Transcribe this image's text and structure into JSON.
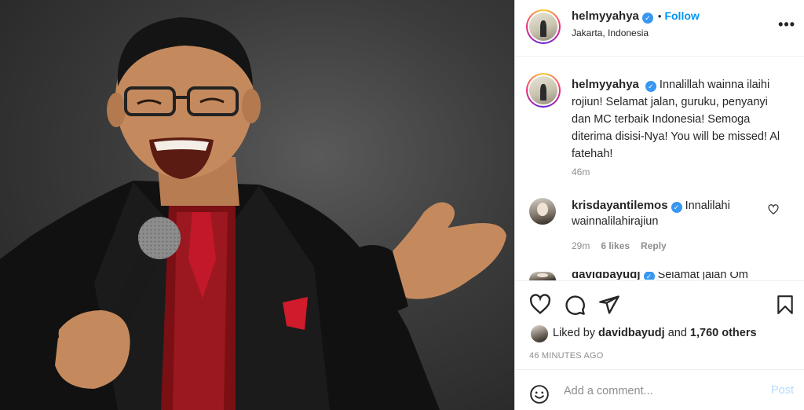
{
  "post": {
    "author": "helmyyahya",
    "follow_label": "Follow",
    "separator": "•",
    "location": "Jakarta, Indonesia",
    "more_label": "•••",
    "verified_mark": "✓"
  },
  "caption": {
    "username": "helmyyahya",
    "text": "Innalillah wainna ilaihi rojiun! Selamat jalan, guruku, penyanyi dan MC terbaik Indonesia! Semoga diterima disisi-Nya! You will be missed! Al fatehah!",
    "time": "46m"
  },
  "comments": [
    {
      "username": "krisdayantilemos",
      "text": "Innalilahi wainnalilahirajiun",
      "time": "29m",
      "likes": "6 likes",
      "reply_label": "Reply"
    },
    {
      "username": "davidbayudj",
      "text": "Selamat jalan Om"
    }
  ],
  "likes": {
    "prefix": "Liked by",
    "user": "davidbayudj",
    "joiner": "and",
    "others": "1,760 others"
  },
  "timestamp": "46 MINUTES AGO",
  "comment_box": {
    "placeholder": "Add a comment...",
    "post_label": "Post"
  },
  "icons": {
    "like": "heart-icon",
    "comment": "comment-icon",
    "share": "paper-plane-icon",
    "save": "bookmark-icon",
    "emoji": "emoji-icon",
    "comment_like": "heart-icon",
    "verified": "verified-badge-icon"
  },
  "colors": {
    "follow": "#0095f6",
    "verified": "#3897f0",
    "post_disabled": "#b3dbff",
    "muted": "#8e8e8e"
  }
}
